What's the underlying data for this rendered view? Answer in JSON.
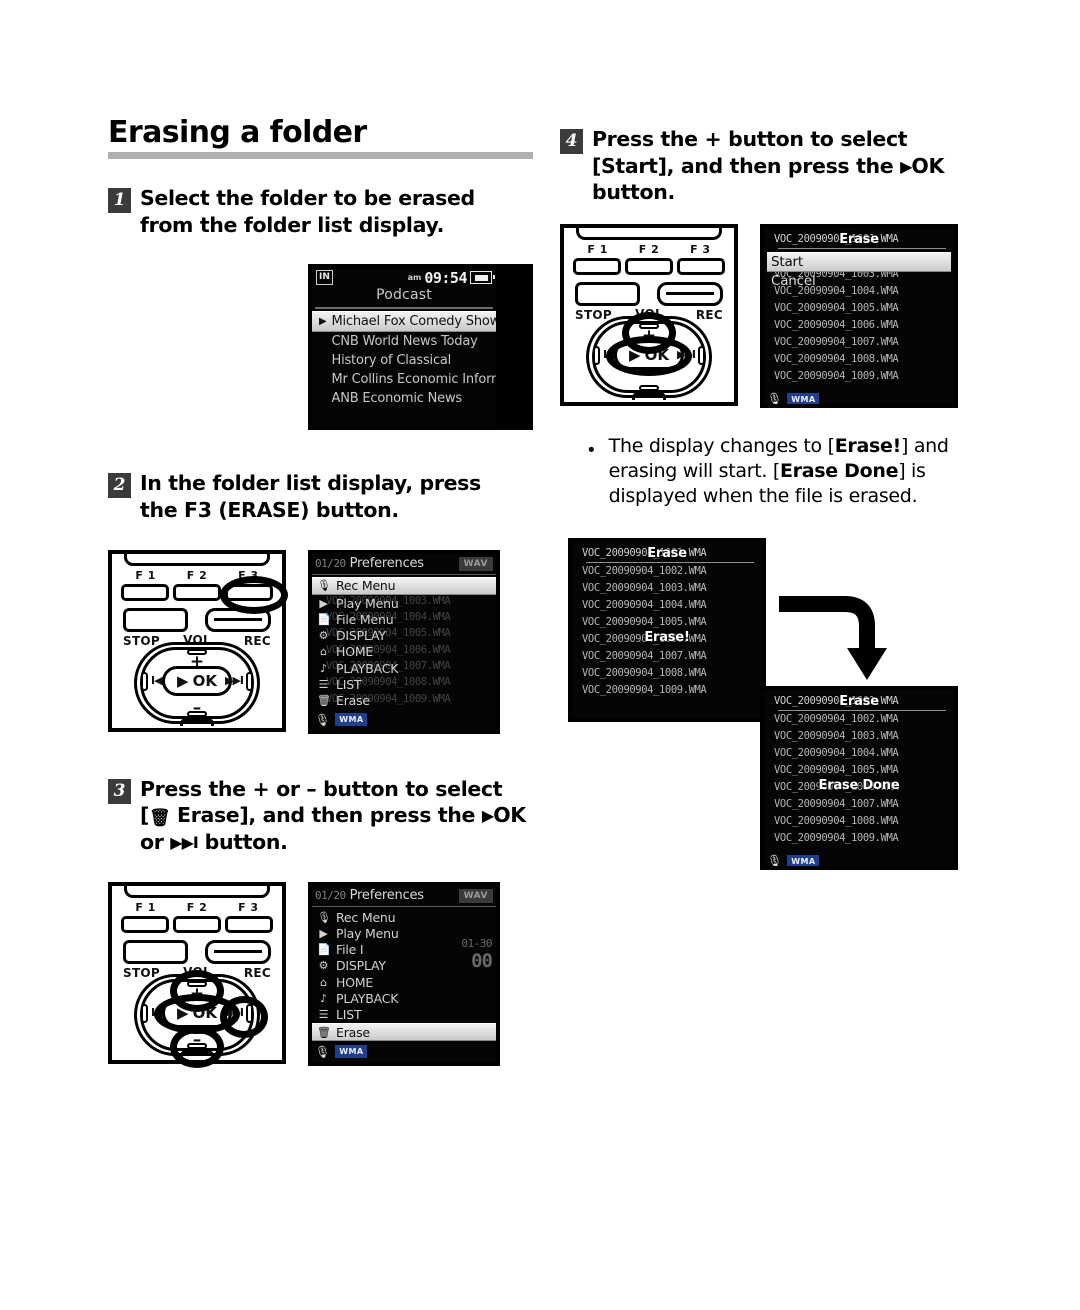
{
  "page": {
    "title": "Erasing a folder"
  },
  "steps": [
    {
      "num": "1",
      "line1": "Select the folder to be erased",
      "line2": "from the folder list display."
    },
    {
      "num": "2",
      "line1": "In the folder list display, press",
      "line2": "the F3 (ERASE) button."
    },
    {
      "num": "3",
      "line1": "Press the + or – button to select",
      "line2_a": "[",
      "line2_trash": "🗑",
      "line2_b": " Erase], and then press the ",
      "line2_tri": "▶",
      "line2_c": "OK",
      "line3_a": "or ",
      "line3_tri": "▶▶I",
      "line3_b": " button."
    },
    {
      "num": "4",
      "line1": "Press the + button to select",
      "line2_a": "[Start], and then press the ",
      "line2_tri": "▶",
      "line2_b": "OK",
      "line3": "button."
    }
  ],
  "note": {
    "bullet": "•",
    "part1": "The display changes to [",
    "bold1": "Erase!",
    "part2": "] and erasing will start. [",
    "bold2": "Erase Done",
    "part3": "] is displayed when the file is erased."
  },
  "device": {
    "f1": "F 1",
    "f2": "F 2",
    "f3": "F 3",
    "stop": "STOP",
    "vol": "VOL",
    "rec": "REC",
    "ok": "OK",
    "ok_tri": "▶",
    "plus": "+",
    "minus": "–",
    "prev": "I◀◀",
    "next": "▶▶I"
  },
  "lcd_podcast": {
    "badge": "IN",
    "ampm": "am",
    "clock": "09:54",
    "folder_title": "Podcast",
    "items": [
      "Michael Fox Comedy Show",
      "CNB World News Today",
      "History of Classical",
      "Mr Collins Economic Informat",
      "ANB Economic News"
    ],
    "selected_index": 0,
    "play_arrow": "▶"
  },
  "lcd_menu": {
    "count": "01/20",
    "title": "Preferences",
    "format_badge": "WAV",
    "items": [
      {
        "icon": "🎙",
        "label": "Rec Menu"
      },
      {
        "icon": "▶",
        "label": "Play Menu"
      },
      {
        "icon": "📄",
        "label": "File Menu"
      },
      {
        "icon": "⚙",
        "label": "DISPLAY"
      },
      {
        "icon": "⌂",
        "label": "HOME"
      },
      {
        "icon": "♪",
        "label": "PLAYBACK"
      },
      {
        "icon": "☰",
        "label": "LIST"
      },
      {
        "icon": "🗑",
        "label": "Erase"
      }
    ],
    "selected_step2": "Rec Menu",
    "selected_step3": "Erase",
    "step3_item3_label": "File I",
    "ghost_right_top": "01-30",
    "ghost_right_bottom": "00",
    "mic_icon": "🎙",
    "wma_badge": "WMA"
  },
  "lcd_files": {
    "files": [
      "VOC_20090904_1001.WMA",
      "VOC_20090904_1002.WMA",
      "VOC_20090904_1003.WMA",
      "VOC_20090904_1004.WMA",
      "VOC_20090904_1005.WMA",
      "VOC_20090904_1006.WMA",
      "VOC_20090904_1007.WMA",
      "VOC_20090904_1008.WMA",
      "VOC_20090904_1009.WMA"
    ],
    "overlay_erase": "Erase",
    "overlay_erase_bang": "Erase!",
    "overlay_erase_done": "Erase Done",
    "dialog": {
      "start": "Start",
      "cancel": "Cancel"
    },
    "mic_icon": "🎙",
    "wma_badge": "WMA"
  },
  "colors": {
    "rule": "#b0b0b0",
    "step_num_bg": "#3b3b3b",
    "lcd_bg": "#050505",
    "lcd_text": "#c7c7c7",
    "wma_badge_bg": "#1f3f8f"
  }
}
